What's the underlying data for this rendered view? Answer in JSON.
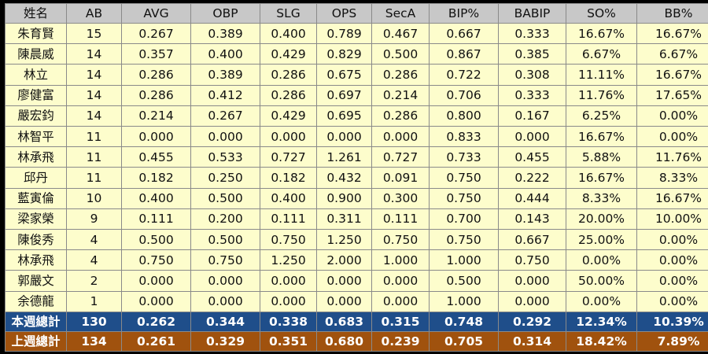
{
  "headers": [
    "姓名",
    "AB",
    "AVG",
    "OBP",
    "SLG",
    "OPS",
    "SecA",
    "BIP%",
    "BABIP",
    "SO%",
    "BB%"
  ],
  "rows": [
    [
      "朱育賢",
      "15",
      "0.267",
      "0.389",
      "0.400",
      "0.789",
      "0.467",
      "0.667",
      "0.333",
      "16.67%",
      "16.67%"
    ],
    [
      "陳晨威",
      "14",
      "0.357",
      "0.400",
      "0.429",
      "0.829",
      "0.500",
      "0.867",
      "0.385",
      "6.67%",
      "6.67%"
    ],
    [
      "林立",
      "14",
      "0.286",
      "0.389",
      "0.286",
      "0.675",
      "0.286",
      "0.722",
      "0.308",
      "11.11%",
      "16.67%"
    ],
    [
      "廖健富",
      "14",
      "0.286",
      "0.412",
      "0.286",
      "0.697",
      "0.214",
      "0.706",
      "0.333",
      "11.76%",
      "17.65%"
    ],
    [
      "嚴宏鈞",
      "14",
      "0.214",
      "0.267",
      "0.429",
      "0.695",
      "0.286",
      "0.800",
      "0.167",
      "6.25%",
      "0.00%"
    ],
    [
      "林智平",
      "11",
      "0.000",
      "0.000",
      "0.000",
      "0.000",
      "0.000",
      "0.833",
      "0.000",
      "16.67%",
      "0.00%"
    ],
    [
      "林承飛",
      "11",
      "0.455",
      "0.533",
      "0.727",
      "1.261",
      "0.727",
      "0.733",
      "0.455",
      "5.88%",
      "11.76%"
    ],
    [
      "邱丹",
      "11",
      "0.182",
      "0.250",
      "0.182",
      "0.432",
      "0.091",
      "0.750",
      "0.222",
      "16.67%",
      "8.33%"
    ],
    [
      "藍寅倫",
      "10",
      "0.400",
      "0.500",
      "0.400",
      "0.900",
      "0.300",
      "0.750",
      "0.444",
      "8.33%",
      "16.67%"
    ],
    [
      "梁家榮",
      "9",
      "0.111",
      "0.200",
      "0.111",
      "0.311",
      "0.111",
      "0.700",
      "0.143",
      "20.00%",
      "10.00%"
    ],
    [
      "陳俊秀",
      "4",
      "0.500",
      "0.500",
      "0.750",
      "1.250",
      "0.750",
      "0.750",
      "0.667",
      "25.00%",
      "0.00%"
    ],
    [
      "林承飛",
      "4",
      "0.750",
      "0.750",
      "1.250",
      "2.000",
      "1.000",
      "1.000",
      "0.750",
      "0.00%",
      "0.00%"
    ],
    [
      "郭嚴文",
      "2",
      "0.000",
      "0.000",
      "0.000",
      "0.000",
      "0.000",
      "0.500",
      "0.000",
      "50.00%",
      "0.00%"
    ],
    [
      "余德龍",
      "1",
      "0.000",
      "0.000",
      "0.000",
      "0.000",
      "0.000",
      "1.000",
      "0.000",
      "0.00%",
      "0.00%"
    ]
  ],
  "totals": [
    [
      "本週總計",
      "130",
      "0.262",
      "0.344",
      "0.338",
      "0.683",
      "0.315",
      "0.748",
      "0.292",
      "12.34%",
      "10.39%"
    ],
    [
      "上週總計",
      "134",
      "0.261",
      "0.329",
      "0.351",
      "0.680",
      "0.239",
      "0.705",
      "0.314",
      "18.42%",
      "7.89%"
    ]
  ],
  "colors": {
    "header_bg": "#c8c8c8",
    "row_bg": "#fdfdcc",
    "this_week_bg": "#1f4e8a",
    "last_week_bg": "#a0520e",
    "border": "#8a8a8a"
  }
}
